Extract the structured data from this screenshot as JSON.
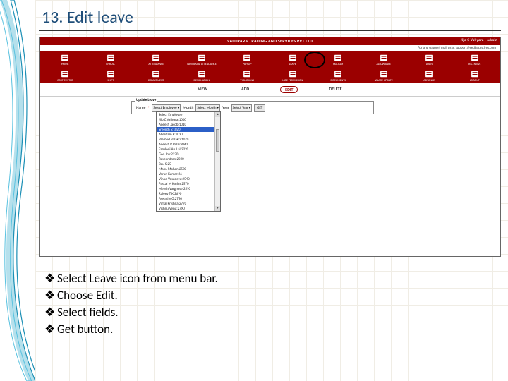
{
  "heading": "13. Edit leave",
  "company_bar": "VALLIYARA TRADING AND SERVICES PVT LTD",
  "top_right_user": "Jijo C Valiyara - admin",
  "support_bar": "For any support mail us at support@redbackstires.com",
  "icons_row1": [
    "HOME",
    "ENROLL",
    "ATTENDANCE",
    "INDIVIDUAL ATTENDANCE",
    "PAYSLIP",
    "LEAVE",
    "HOLIDAY",
    "ALLOWANCE",
    "LOAN",
    "INCENTIVE"
  ],
  "icons_row2": [
    "COST CENTER",
    "SHIFT",
    "DEPARTMENT",
    "DESIGNATION",
    "VIOLATIONS",
    "LATE PERMISSION",
    "DOCUMENTS",
    "SALARY UPDATE",
    "ADVANCE",
    "LOGOUT"
  ],
  "tabs": {
    "view": "VIEW",
    "add": "ADD",
    "edit": "EDIT",
    "delete": "DELETE"
  },
  "fieldset_legend": "Update Leave",
  "form": {
    "name_label": "Name",
    "name_value": "Select Employee",
    "month_label": "Month",
    "month_value": "Select Month",
    "year_label": "Year",
    "year_value": "Select Year",
    "get": "GET"
  },
  "dropdown": [
    "Select Employee",
    "Jijo C Valiyara:1000",
    "Aneesh Jacob:1010",
    "Sreejith S:1020",
    "Abraham K:1030",
    "Pramod Balakri:1070",
    "Aneesh R Pillai:2040",
    "Faruloni Arul al:2220",
    "Geo Joy:2230",
    "Raveendran:2240",
    "Bau S:25",
    "Manu Mohan:2530",
    "Varun Kumar:26",
    "Vinod Vasudeva:2540",
    "Pascal M Kazim:2570",
    "Melvin Varghese:2590",
    "Rajeev T K:2690",
    "Aswathy G:2750",
    "Vimal Krishna:2770",
    "Vishnu Venu:2790"
  ],
  "dropdown_highlight_index": 3,
  "bullet_glyph": "❖",
  "bullets": [
    "Select Leave icon from menu bar.",
    "Choose Edit.",
    "Select fields.",
    "Get button."
  ]
}
